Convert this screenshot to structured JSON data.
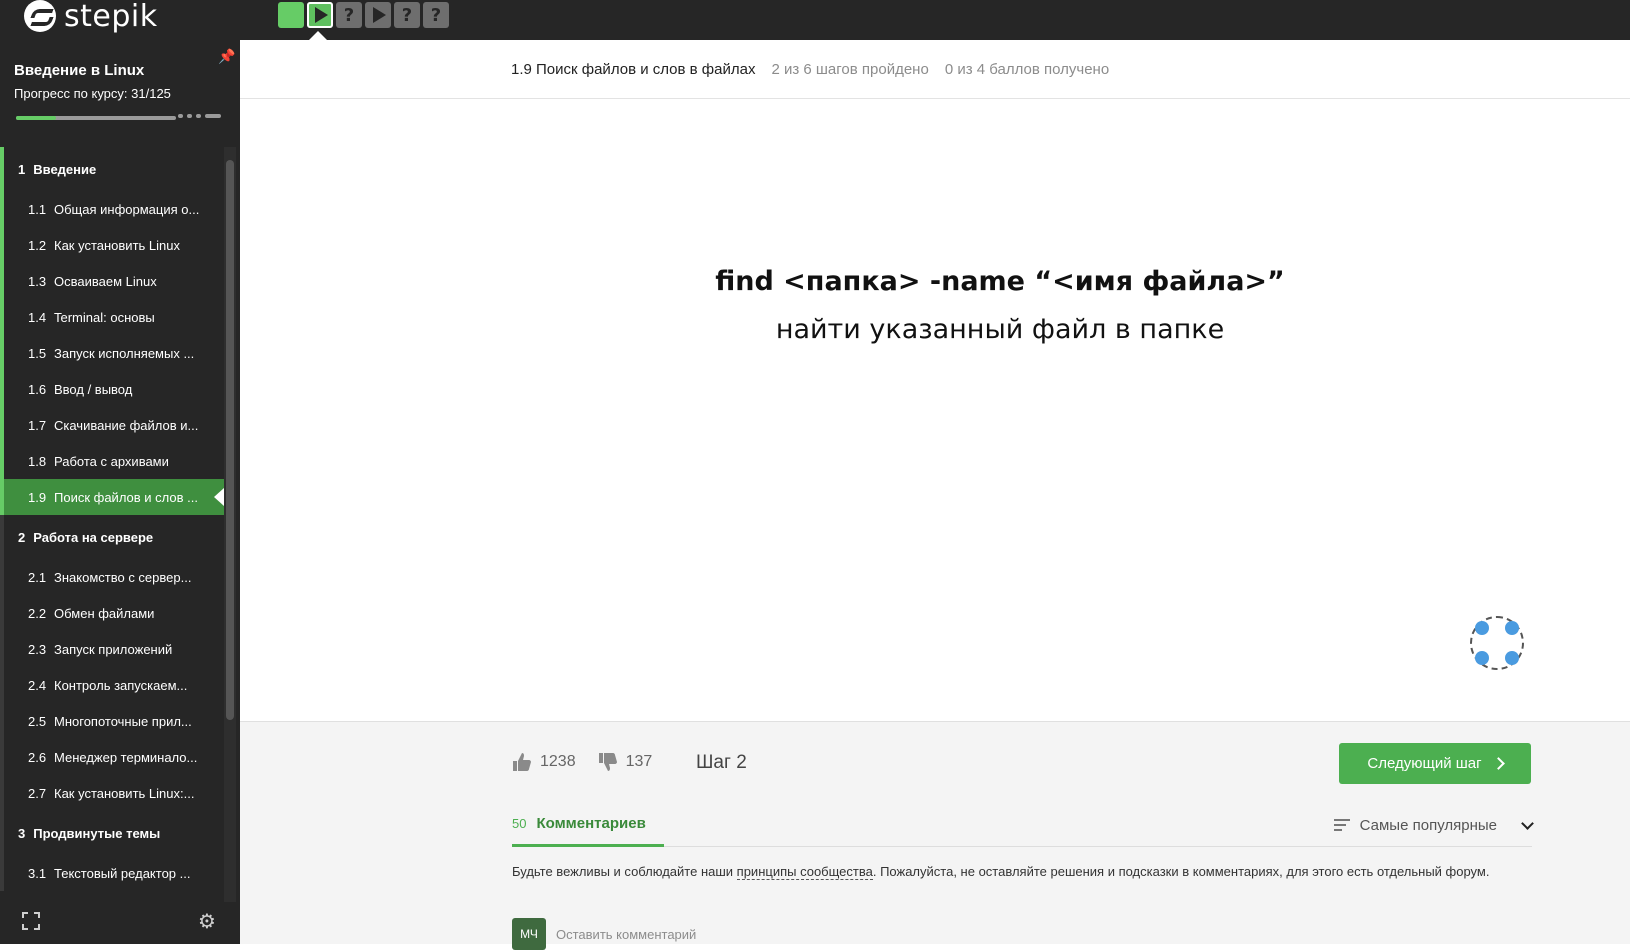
{
  "topbar": {
    "logo_text": "stepik",
    "steps": [
      {
        "state": "done",
        "symbol": ""
      },
      {
        "state": "active",
        "symbol": "play"
      },
      {
        "state": "question",
        "symbol": "?"
      },
      {
        "state": "video",
        "symbol": "play"
      },
      {
        "state": "question",
        "symbol": "?"
      },
      {
        "state": "question",
        "symbol": "?"
      }
    ]
  },
  "sidebar": {
    "course_title": "Введение в Linux",
    "progress_text": "Прогресс по курсу:  31/125",
    "progress_fraction": 0.248,
    "sections": [
      {
        "num": "1",
        "title": "Введение",
        "lessons": [
          {
            "num": "1.1",
            "title": "Общая информация о..."
          },
          {
            "num": "1.2",
            "title": "Как установить Linux"
          },
          {
            "num": "1.3",
            "title": "Осваиваем Linux"
          },
          {
            "num": "1.4",
            "title": "Terminal: основы"
          },
          {
            "num": "1.5",
            "title": "Запуск исполняемых ..."
          },
          {
            "num": "1.6",
            "title": "Ввод / вывод"
          },
          {
            "num": "1.7",
            "title": "Скачивание файлов и..."
          },
          {
            "num": "1.8",
            "title": "Работа с архивами"
          },
          {
            "num": "1.9",
            "title": "Поиск файлов и слов ..."
          }
        ]
      },
      {
        "num": "2",
        "title": "Работа на сервере",
        "lessons": [
          {
            "num": "2.1",
            "title": "Знакомство с сервер..."
          },
          {
            "num": "2.2",
            "title": "Обмен файлами"
          },
          {
            "num": "2.3",
            "title": "Запуск приложений"
          },
          {
            "num": "2.4",
            "title": "Контроль запускаем..."
          },
          {
            "num": "2.5",
            "title": "Многопоточные прил..."
          },
          {
            "num": "2.6",
            "title": "Менеджер терминало..."
          },
          {
            "num": "2.7",
            "title": "Как установить Linux:..."
          }
        ]
      },
      {
        "num": "3",
        "title": "Продвинутые темы",
        "lessons": [
          {
            "num": "3.1",
            "title": "Текстовый редактор ..."
          }
        ]
      }
    ]
  },
  "lesson_header": {
    "title": "1.9 Поиск файлов и слов в файлах",
    "steps_passed": "2 из 6 шагов пройдено",
    "points": "0 из 4 баллов  получено"
  },
  "slide": {
    "command": "find  <папка>  -name  “<имя файла>”",
    "description": "найти указанный файл в папке"
  },
  "footer": {
    "likes": "1238",
    "dislikes": "137",
    "step_label": "Шаг 2",
    "next_button": "Следующий шаг"
  },
  "comments": {
    "count": "50",
    "tab_label": "Комментариев",
    "sort_label": "Самые популярные",
    "rules_before": "Будьте вежливы и соблюдайте наши ",
    "rules_link": "принципы сообщества",
    "rules_after": ". Пожалуйста, не оставляйте решения и подсказки в комментариях, для этого есть отдельный форум.",
    "avatar_initials": "МЧ",
    "comment_placeholder": "Оставить комментарий"
  },
  "colors": {
    "accent_green": "#4caf50",
    "topbar_bg": "#262626",
    "loader_blue": "#4a9be0"
  }
}
